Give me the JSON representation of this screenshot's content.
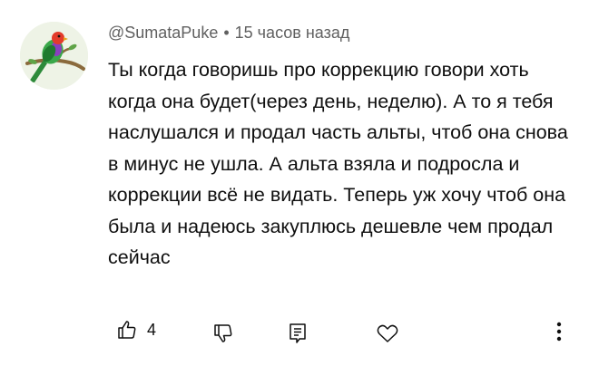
{
  "comment": {
    "author": "@SumataPuke",
    "separator": "•",
    "time": "15 часов назад",
    "text": "Ты когда говоришь про коррекцию говори хоть когда она будет(через день, неделю). А то я тебя наслушался и продал часть альты, чтоб она снова в минус не ушла. А альта взяла и подросла и коррекции всё не видать. Теперь уж хочу чтоб она была и надеюсь закуплюсь дешевле чем продал сейчас",
    "likes": "4"
  },
  "icons": {
    "avatar": "parrot-avatar",
    "like": "thumbs-up-icon",
    "dislike": "thumbs-down-icon",
    "reply": "reply-comment-icon",
    "heart": "heart-icon",
    "more": "more-vertical-icon"
  },
  "colors": {
    "text": "#0f0f0f",
    "meta": "#606060",
    "icon": "#0f0f0f"
  }
}
